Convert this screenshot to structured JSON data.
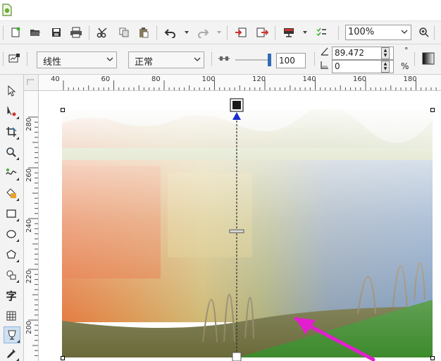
{
  "toolbar": {
    "zoom_value": "100%"
  },
  "property_bar": {
    "fill_type": "线性",
    "blend_mode": "正常",
    "midpoint_value": "100",
    "angle_value": "89.472",
    "edge_pad_value": "0",
    "angle_unit": "°",
    "pad_unit": "%"
  },
  "ruler": {
    "top_labels": [
      "40",
      "60",
      "80",
      "100",
      "120",
      "140",
      "160",
      "180"
    ],
    "left_labels": [
      "280",
      "260",
      "240",
      "220",
      "200"
    ]
  },
  "toolbox": {
    "text_tool_glyph": "字"
  },
  "colors": {
    "accent_arrow": "#e21fce",
    "gradient_handle": "#1b1b1b",
    "gradient_direction": "#1a2bd0"
  }
}
